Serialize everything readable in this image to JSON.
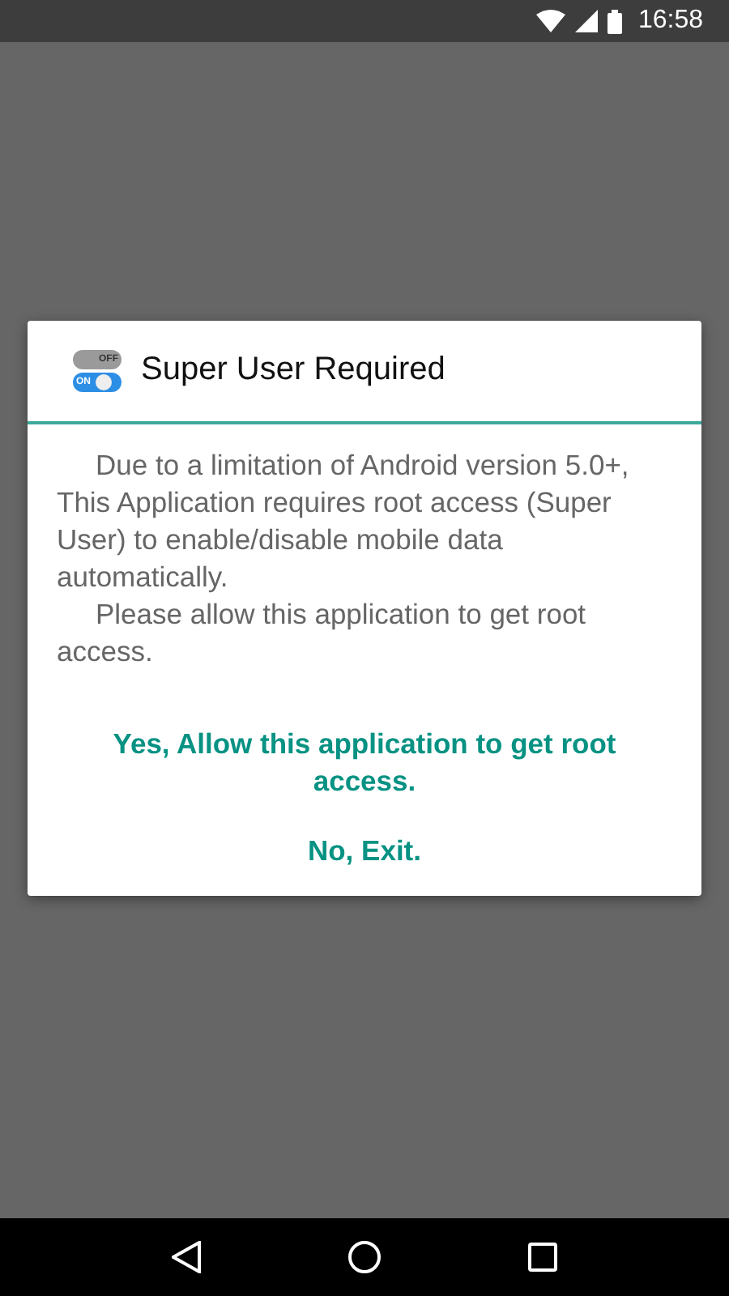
{
  "status_bar": {
    "time": "16:58"
  },
  "dialog": {
    "icon": {
      "off_label": "OFF",
      "on_label": "ON"
    },
    "title": "Super User Required",
    "message": [
      "Due to a limitation of Android version 5.0+, This Application requires root access (Super User) to enable/disable mobile data automatically.",
      "Please allow this application to get root access."
    ],
    "buttons": [
      {
        "label": "Yes, Allow this application to get root access."
      },
      {
        "label": "No, Exit."
      }
    ]
  }
}
